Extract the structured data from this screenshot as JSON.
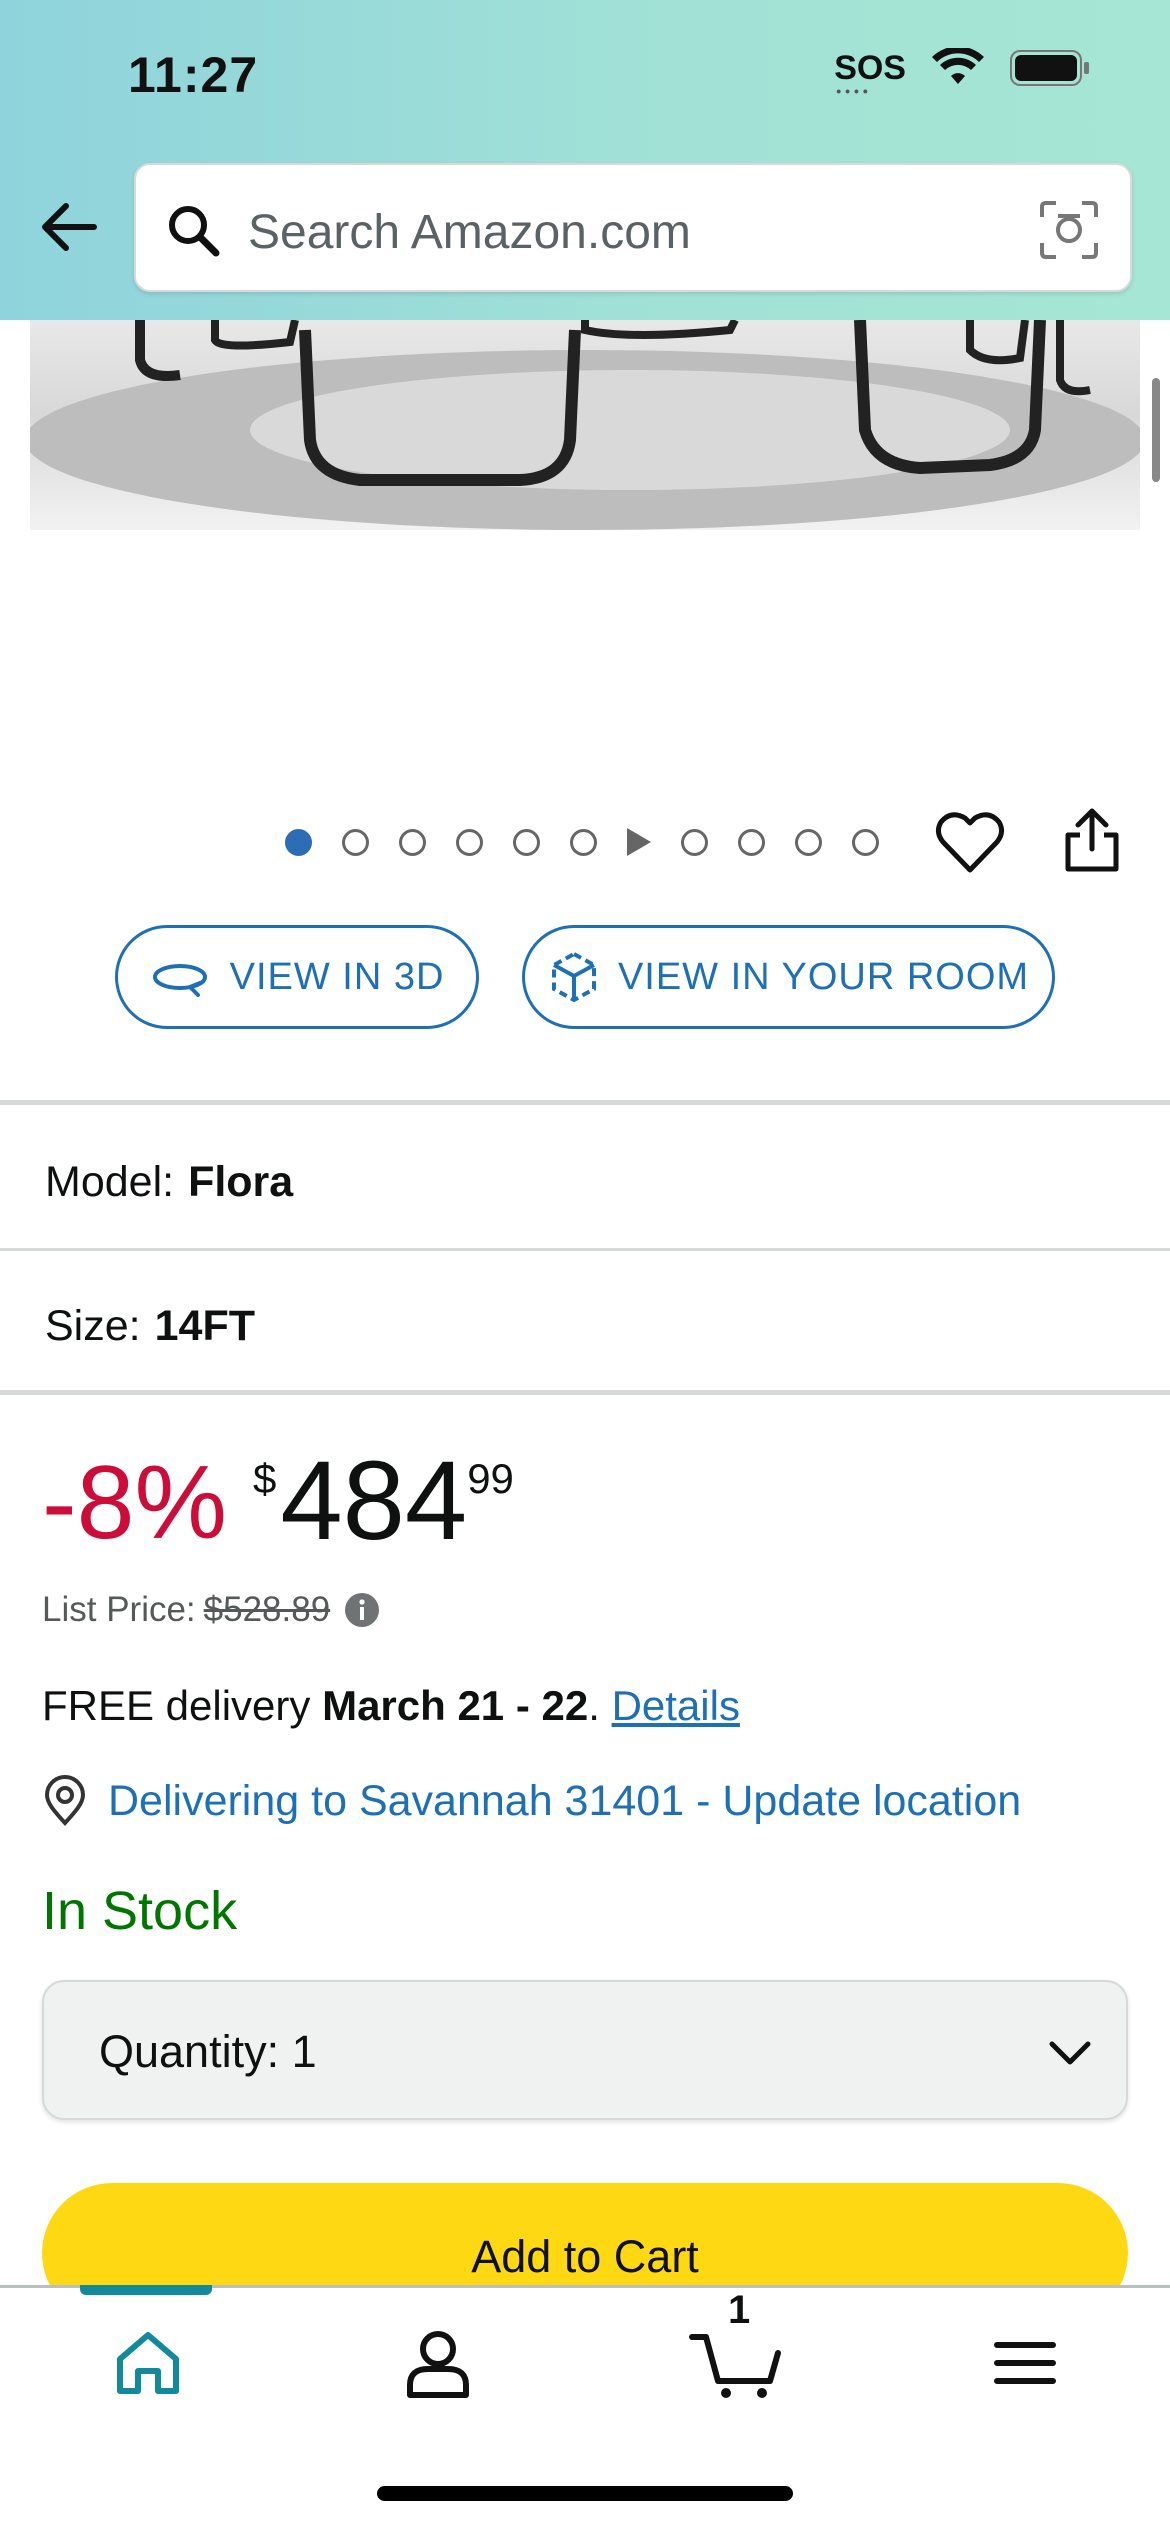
{
  "status_bar": {
    "time": "11:27",
    "sos": "SOS"
  },
  "search": {
    "placeholder": "Search Amazon.com"
  },
  "view_buttons": {
    "view_3d": "VIEW IN 3D",
    "view_room": "VIEW IN YOUR ROOM"
  },
  "variants": {
    "model_label": "Model:",
    "model_value": "Flora",
    "size_label": "Size:",
    "size_value": "14FT"
  },
  "price": {
    "discount": "-8%",
    "currency": "$",
    "whole": "484",
    "fraction": "99",
    "list_label": "List Price:",
    "list_value": "$528.89"
  },
  "delivery": {
    "prefix": "FREE delivery",
    "dates": "March 21 - 22",
    "sep": ". ",
    "link": "Details"
  },
  "location": {
    "text": "Delivering to Savannah 31401 - Update location"
  },
  "stock": "In Stock",
  "quantity": {
    "label": "Quantity:",
    "value": "1"
  },
  "add_to_cart": "Add to Cart",
  "bottom_nav": {
    "cart_count": "1"
  },
  "colors": {
    "accent_blue": "#1d6fb8",
    "price_red": "#cc0c39",
    "stock_green": "#007600",
    "cart_yellow": "#ffd814",
    "nav_teal": "#138a9c"
  }
}
